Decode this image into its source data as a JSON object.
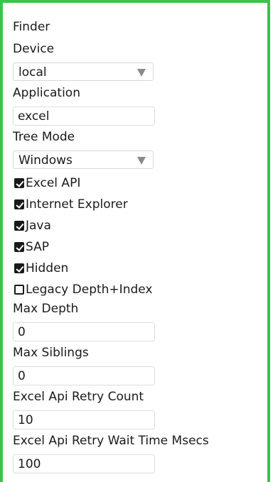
{
  "panel": {
    "title": "Finder",
    "device": {
      "label": "Device",
      "value": "local"
    },
    "application": {
      "label": "Application",
      "value": "excel"
    },
    "tree_mode": {
      "label": "Tree Mode",
      "value": "Windows"
    },
    "checkboxes": [
      {
        "label": "Excel API",
        "checked": true
      },
      {
        "label": "Internet Explorer",
        "checked": true
      },
      {
        "label": "Java",
        "checked": true
      },
      {
        "label": "SAP",
        "checked": true
      },
      {
        "label": "Hidden",
        "checked": true
      },
      {
        "label": "Legacy Depth+Index",
        "checked": false
      }
    ],
    "max_depth": {
      "label": "Max Depth",
      "value": "0"
    },
    "max_siblings": {
      "label": "Max Siblings",
      "value": "0"
    },
    "retry_count": {
      "label": "Excel Api Retry Count",
      "value": "10"
    },
    "retry_wait": {
      "label": "Excel Api Retry Wait Time Msecs",
      "value": "100"
    }
  },
  "colors": {
    "border_accent": "#3cc24a",
    "checkbox_fill": "#1a1a1a"
  }
}
